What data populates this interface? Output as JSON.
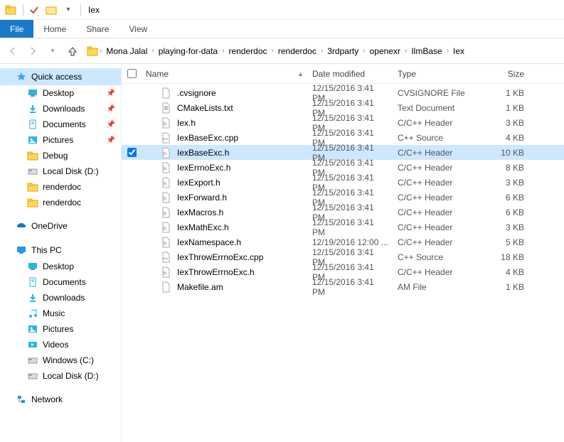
{
  "titlebar": {
    "title": "Iex"
  },
  "ribbon": {
    "file": "File",
    "home": "Home",
    "share": "Share",
    "view": "View"
  },
  "breadcrumb": [
    "Mona Jalal",
    "playing-for-data",
    "renderdoc",
    "renderdoc",
    "3rdparty",
    "openexr",
    "IlmBase",
    "Iex"
  ],
  "columns": {
    "name": "Name",
    "date": "Date modified",
    "type": "Type",
    "size": "Size"
  },
  "sidebar": {
    "quick_access": "Quick access",
    "onedrive": "OneDrive",
    "this_pc": "This PC",
    "network": "Network",
    "quick_items": [
      {
        "label": "Desktop",
        "pinned": true,
        "icon": "desktop"
      },
      {
        "label": "Downloads",
        "pinned": true,
        "icon": "downloads"
      },
      {
        "label": "Documents",
        "pinned": true,
        "icon": "documents"
      },
      {
        "label": "Pictures",
        "pinned": true,
        "icon": "pictures"
      },
      {
        "label": "Debug",
        "pinned": false,
        "icon": "folder"
      },
      {
        "label": "Local Disk (D:)",
        "pinned": false,
        "icon": "disk"
      },
      {
        "label": "renderdoc",
        "pinned": false,
        "icon": "folder"
      },
      {
        "label": "renderdoc",
        "pinned": false,
        "icon": "folder"
      }
    ],
    "pc_items": [
      {
        "label": "Desktop",
        "icon": "desktop"
      },
      {
        "label": "Documents",
        "icon": "documents"
      },
      {
        "label": "Downloads",
        "icon": "downloads"
      },
      {
        "label": "Music",
        "icon": "music"
      },
      {
        "label": "Pictures",
        "icon": "pictures"
      },
      {
        "label": "Videos",
        "icon": "videos"
      },
      {
        "label": "Windows (C:)",
        "icon": "disk"
      },
      {
        "label": "Local Disk (D:)",
        "icon": "disk"
      }
    ]
  },
  "files": [
    {
      "name": ".cvsignore",
      "date": "12/15/2016 3:41 PM",
      "type": "CVSIGNORE File",
      "size": "1 KB",
      "icon": "file",
      "selected": false
    },
    {
      "name": "CMakeLists.txt",
      "date": "12/15/2016 3:41 PM",
      "type": "Text Document",
      "size": "1 KB",
      "icon": "txt",
      "selected": false
    },
    {
      "name": "Iex.h",
      "date": "12/15/2016 3:41 PM",
      "type": "C/C++ Header",
      "size": "3 KB",
      "icon": "h",
      "selected": false
    },
    {
      "name": "IexBaseExc.cpp",
      "date": "12/15/2016 3:41 PM",
      "type": "C++ Source",
      "size": "4 KB",
      "icon": "cpp",
      "selected": false
    },
    {
      "name": "IexBaseExc.h",
      "date": "12/15/2016 3:41 PM",
      "type": "C/C++ Header",
      "size": "10 KB",
      "icon": "h",
      "selected": true
    },
    {
      "name": "IexErrnoExc.h",
      "date": "12/15/2016 3:41 PM",
      "type": "C/C++ Header",
      "size": "8 KB",
      "icon": "h",
      "selected": false
    },
    {
      "name": "IexExport.h",
      "date": "12/15/2016 3:41 PM",
      "type": "C/C++ Header",
      "size": "3 KB",
      "icon": "h",
      "selected": false
    },
    {
      "name": "IexForward.h",
      "date": "12/15/2016 3:41 PM",
      "type": "C/C++ Header",
      "size": "6 KB",
      "icon": "h",
      "selected": false
    },
    {
      "name": "IexMacros.h",
      "date": "12/15/2016 3:41 PM",
      "type": "C/C++ Header",
      "size": "6 KB",
      "icon": "h",
      "selected": false
    },
    {
      "name": "IexMathExc.h",
      "date": "12/15/2016 3:41 PM",
      "type": "C/C++ Header",
      "size": "3 KB",
      "icon": "h",
      "selected": false
    },
    {
      "name": "IexNamespace.h",
      "date": "12/19/2016 12:00 ...",
      "type": "C/C++ Header",
      "size": "5 KB",
      "icon": "h",
      "selected": false
    },
    {
      "name": "IexThrowErrnoExc.cpp",
      "date": "12/15/2016 3:41 PM",
      "type": "C++ Source",
      "size": "18 KB",
      "icon": "cpp",
      "selected": false
    },
    {
      "name": "IexThrowErrnoExc.h",
      "date": "12/15/2016 3:41 PM",
      "type": "C/C++ Header",
      "size": "4 KB",
      "icon": "h",
      "selected": false
    },
    {
      "name": "Makefile.am",
      "date": "12/15/2016 3:41 PM",
      "type": "AM File",
      "size": "1 KB",
      "icon": "file",
      "selected": false
    }
  ]
}
